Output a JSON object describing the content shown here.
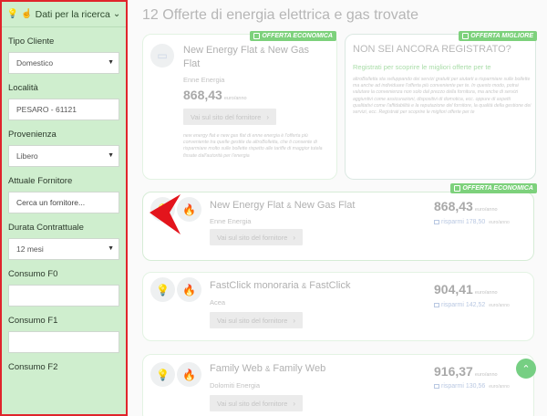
{
  "sidebar": {
    "header": "Dati per la ricerca",
    "fields": [
      {
        "label": "Tipo Cliente",
        "value": "Domestico",
        "kind": "select"
      },
      {
        "label": "Località",
        "value": "PESARO - 61121",
        "kind": "text"
      },
      {
        "label": "Provenienza",
        "value": "Libero",
        "kind": "select"
      },
      {
        "label": "Attuale Fornitore",
        "placeholder": "Cerca un fornitore...",
        "kind": "text"
      },
      {
        "label": "Durata Contrattuale",
        "value": "12 mesi",
        "kind": "select"
      },
      {
        "label": "Consumo F0",
        "value": "",
        "kind": "text"
      },
      {
        "label": "Consumo F1",
        "value": "",
        "kind": "text"
      },
      {
        "label": "Consumo F2",
        "value": "",
        "kind": "text"
      }
    ]
  },
  "main": {
    "title": "12 Offerte di energia elettrica e gas trovate",
    "featured": {
      "badge": "OFFERTA ECONOMICA",
      "offer_a": "New Energy Flat",
      "amp": "&",
      "offer_b": "New Gas Flat",
      "provider": "Enne Energia",
      "price": "868,43",
      "price_unit": "euro/anno",
      "cta": "Vai sul sito del fornitore",
      "fine_print": "new energy flat e new gas flat di enne energia è l'offerta più conveniente tra quelle gestite da altroBolletta, che ti consente di risparmiare molto sulle bollette rispetto alle tariffe di maggior tutela fissate dall'autorità per l'energia"
    },
    "register": {
      "badge": "OFFERTA MIGLIORE",
      "title": "NON SEI ANCORA REGISTRATO?",
      "subtitle": "Registrati per scoprire le migliori offerte per te",
      "fine_print": "altroBolletta sta sviluppando dei servizi gratuiti per aiutarti a risparmiare sulle bollette ma anche ad individuare l'offerta più conveniente per te. In questo modo, potrai valutare la convenienza non solo dal prezzo della fornitura, ma anche di servizi aggiuntivi come assicurazioni, dispositivi di domotica, ecc. oppure di aspetti qualitativi come l'affidabilità e la reputazione del fornitore, la qualità della gestione dei servizi, ecc. Registrati per scoprire le migliori offerte per te"
    },
    "offers": [
      {
        "badge": "OFFERTA ECONOMICA",
        "name_a": "New Energy Flat",
        "name_b": "New Gas Flat",
        "provider": "Enne Energia",
        "price": "868,43",
        "price_unit": "euro/anno",
        "saving": "risparmi 178,50",
        "saving_unit": "euro/anno",
        "cta": "Vai sul sito del fornitore"
      },
      {
        "badge": "",
        "name_a": "FastClick monoraria",
        "name_b": "FastClick",
        "provider": "Acea",
        "price": "904,41",
        "price_unit": "euro/anno",
        "saving": "risparmi 142,52",
        "saving_unit": "euro/anno",
        "cta": "Vai sul sito del fornitore"
      },
      {
        "badge": "",
        "name_a": "Family Web",
        "name_b": "Family Web",
        "provider": "Dolomiti Energia",
        "price": "916,37",
        "price_unit": "euro/anno",
        "saving": "risparmi 130,56",
        "saving_unit": "euro/anno",
        "cta": "Vai sul sito del fornitore"
      }
    ],
    "amp": "&"
  },
  "colors": {
    "accent_green": "#7dd17c",
    "sidebar_bg": "#cfeece",
    "highlight_red": "#e0242b"
  }
}
